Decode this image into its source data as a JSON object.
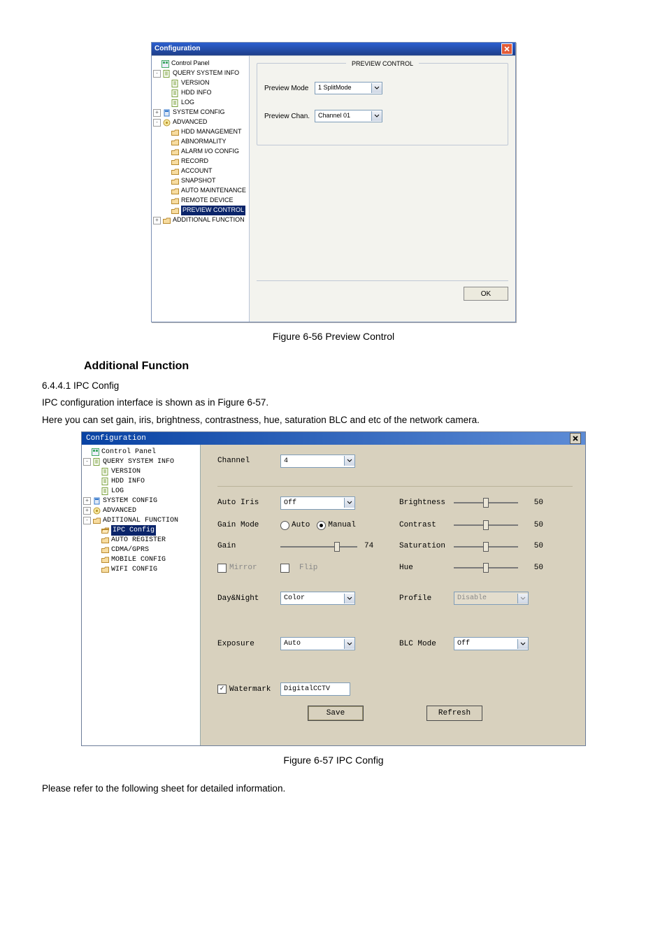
{
  "doc": {
    "fig56_caption": "Figure 6-56 Preview Control",
    "section_title": "Additional Function",
    "sub_num": "6.4.4.1 IPC Config",
    "para1": "IPC configuration interface is shown as in Figure 6-57.",
    "para2": "Here you can set gain, iris, brightness, contrastness, hue, saturation BLC and etc of the network camera.",
    "fig57_caption": "Figure 6-57 IPC Config",
    "footer": "Please refer to the following sheet for detailed information."
  },
  "win1": {
    "title": "Configuration",
    "tree": [
      {
        "indent": 0,
        "exp": " ",
        "icon": "panel",
        "label": "Control Panel"
      },
      {
        "indent": 0,
        "exp": "-",
        "icon": "doc",
        "label": "QUERY SYSTEM INFO"
      },
      {
        "indent": 1,
        "exp": " ",
        "icon": "doc",
        "label": "VERSION"
      },
      {
        "indent": 1,
        "exp": " ",
        "icon": "doc",
        "label": "HDD INFO"
      },
      {
        "indent": 1,
        "exp": " ",
        "icon": "doc",
        "label": "LOG"
      },
      {
        "indent": 0,
        "exp": "+",
        "icon": "cfg",
        "label": "SYSTEM CONFIG"
      },
      {
        "indent": 0,
        "exp": "-",
        "icon": "adv",
        "label": "ADVANCED"
      },
      {
        "indent": 1,
        "exp": " ",
        "icon": "folder",
        "label": "HDD MANAGEMENT"
      },
      {
        "indent": 1,
        "exp": " ",
        "icon": "folder",
        "label": "ABNORMALITY"
      },
      {
        "indent": 1,
        "exp": " ",
        "icon": "folder",
        "label": "ALARM I/O CONFIG"
      },
      {
        "indent": 1,
        "exp": " ",
        "icon": "folder",
        "label": "RECORD"
      },
      {
        "indent": 1,
        "exp": " ",
        "icon": "folder",
        "label": "ACCOUNT"
      },
      {
        "indent": 1,
        "exp": " ",
        "icon": "folder",
        "label": "SNAPSHOT"
      },
      {
        "indent": 1,
        "exp": " ",
        "icon": "folder",
        "label": "AUTO MAINTENANCE"
      },
      {
        "indent": 1,
        "exp": " ",
        "icon": "folder",
        "label": "REMOTE DEVICE"
      },
      {
        "indent": 1,
        "exp": " ",
        "icon": "folder",
        "label": "PREVIEW CONTROL",
        "selected": true
      },
      {
        "indent": 0,
        "exp": "+",
        "icon": "folder",
        "label": "ADDITIONAL FUNCTION"
      }
    ],
    "group_title": "PREVIEW CONTROL",
    "mode_label": "Preview Mode",
    "mode_value": "1 SplitMode",
    "chan_label": "Preview Chan.",
    "chan_value": "Channel 01",
    "ok": "OK"
  },
  "win2": {
    "title": "Configuration",
    "tree": [
      {
        "indent": 0,
        "exp": " ",
        "icon": "panel",
        "label": "Control Panel"
      },
      {
        "indent": 0,
        "exp": "-",
        "icon": "doc",
        "label": "QUERY SYSTEM INFO"
      },
      {
        "indent": 1,
        "exp": " ",
        "icon": "doc",
        "label": "VERSION"
      },
      {
        "indent": 1,
        "exp": " ",
        "icon": "doc",
        "label": "HDD INFO"
      },
      {
        "indent": 1,
        "exp": " ",
        "icon": "doc",
        "label": "LOG"
      },
      {
        "indent": 0,
        "exp": "+",
        "icon": "cfg",
        "label": "SYSTEM CONFIG"
      },
      {
        "indent": 0,
        "exp": "+",
        "icon": "adv",
        "label": "ADVANCED"
      },
      {
        "indent": 0,
        "exp": "-",
        "icon": "folder",
        "label": "ADITIONAL FUNCTION"
      },
      {
        "indent": 1,
        "exp": " ",
        "icon": "folder-open",
        "label": "IPC Config",
        "selected": true
      },
      {
        "indent": 1,
        "exp": " ",
        "icon": "folder",
        "label": "AUTO REGISTER"
      },
      {
        "indent": 1,
        "exp": " ",
        "icon": "folder",
        "label": "CDMA/GPRS"
      },
      {
        "indent": 1,
        "exp": " ",
        "icon": "folder",
        "label": "MOBILE CONFIG"
      },
      {
        "indent": 1,
        "exp": " ",
        "icon": "folder",
        "label": "WIFI CONFIG"
      }
    ],
    "channel_label": "Channel",
    "channel_value": "4",
    "autoiris_label": "Auto Iris",
    "autoiris_value": "Off",
    "brightness_label": "Brightness",
    "brightness_value": "50",
    "gainmode_label": "Gain Mode",
    "gainmode_auto": "Auto",
    "gainmode_manual": "Manual",
    "contrast_label": "Contrast",
    "contrast_value": "50",
    "gain_label": "Gain",
    "gain_value": "74",
    "saturation_label": "Saturation",
    "saturation_value": "50",
    "mirror_label": "Mirror",
    "flip_label": "Flip",
    "hue_label": "Hue",
    "hue_value": "50",
    "daynight_label": "Day&Night",
    "daynight_value": "Color",
    "profile_label": "Profile",
    "profile_value": "Disable",
    "exposure_label": "Exposure",
    "exposure_value": "Auto",
    "blc_label": "BLC Mode",
    "blc_value": "Off",
    "watermark_label": "Watermark",
    "watermark_value": "DigitalCCTV",
    "save": "Save",
    "refresh": "Refresh"
  }
}
